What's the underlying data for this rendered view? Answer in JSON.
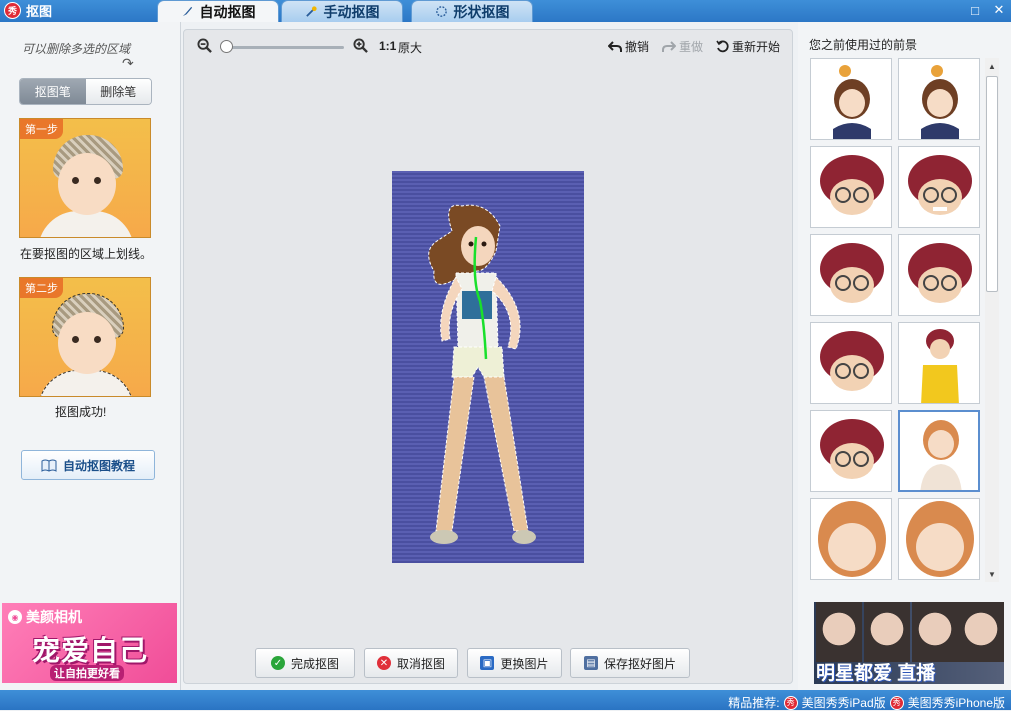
{
  "app": {
    "title": "抠图",
    "logo_text": "秀"
  },
  "tabs": [
    {
      "label": "自动抠图",
      "icon": "brush-icon",
      "active": true
    },
    {
      "label": "手动抠图",
      "icon": "magic-wand-icon",
      "active": false
    },
    {
      "label": "形状抠图",
      "icon": "shape-icon",
      "active": false
    }
  ],
  "window": {
    "maximize": "□",
    "close": "✕"
  },
  "left": {
    "hint": "可以删除多选的区域",
    "seg_brush": "抠图笔",
    "seg_erase": "删除笔",
    "step1_badge": "第一步",
    "step1_text": "在要抠图的区域上划线。",
    "step2_badge": "第二步",
    "step2_text": "抠图成功!",
    "tutorial": "自动抠图教程",
    "ad_brand": "美颜相机",
    "ad_slogan": "宠爱自己",
    "ad_sub": "让自拍更好看"
  },
  "toolbar": {
    "ratio": "1:1",
    "ratio_label": "原大",
    "zoom_level": 0,
    "undo": "撤销",
    "redo": "重做",
    "restart": "重新开始"
  },
  "actions": {
    "finish": "完成抠图",
    "cancel": "取消抠图",
    "replace": "更换图片",
    "save": "保存抠好图片"
  },
  "right": {
    "title": "您之前使用过的前景",
    "ad_text": "明星都爱 直播"
  },
  "status": {
    "label": "精品推荐:",
    "ipad": "美图秀秀iPad版",
    "iphone": "美图秀秀iPhone版"
  },
  "colors": {
    "accent": "#2c77c6",
    "ad_pink": "#f04d98",
    "canvas_bg": "#4a4fa0"
  }
}
